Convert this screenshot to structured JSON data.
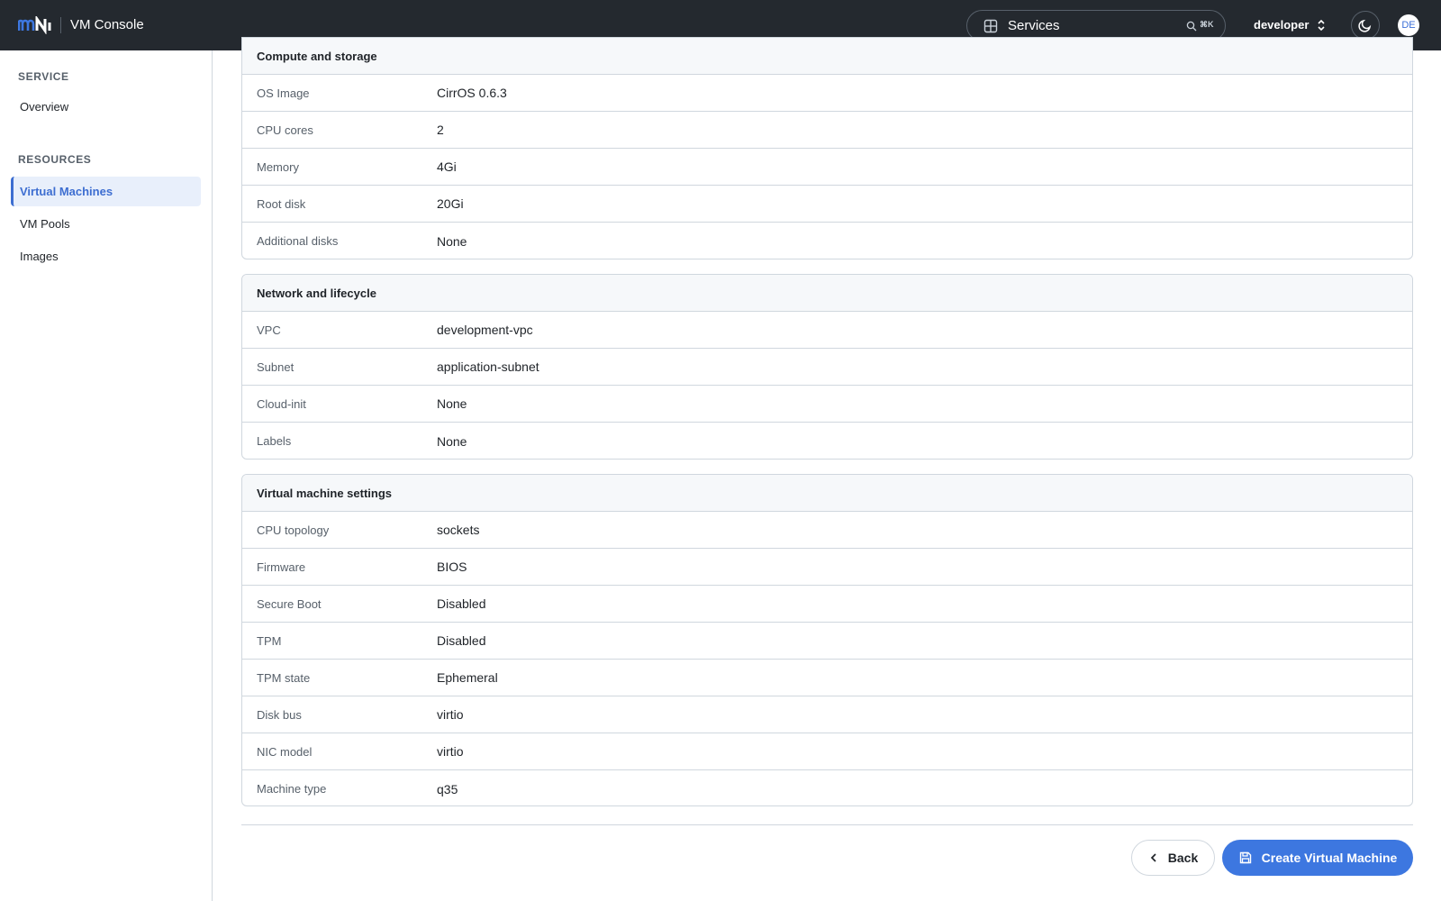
{
  "app": {
    "title": "VM Console"
  },
  "search": {
    "label": "Services",
    "shortcut": "⌘K"
  },
  "user": {
    "name": "developer",
    "initials": "DE"
  },
  "sidebar": {
    "sections": [
      {
        "title": "SERVICE",
        "items": [
          {
            "label": "Overview",
            "active": false
          }
        ]
      },
      {
        "title": "RESOURCES",
        "items": [
          {
            "label": "Virtual Machines",
            "active": true
          },
          {
            "label": "VM Pools",
            "active": false
          },
          {
            "label": "Images",
            "active": false
          }
        ]
      }
    ]
  },
  "cards": [
    {
      "title": "Compute and storage",
      "rows": [
        {
          "label": "OS Image",
          "value": "CirrOS 0.6.3"
        },
        {
          "label": "CPU cores",
          "value": "2"
        },
        {
          "label": "Memory",
          "value": "4Gi"
        },
        {
          "label": "Root disk",
          "value": "20Gi"
        },
        {
          "label": "Additional disks",
          "value": "None"
        }
      ]
    },
    {
      "title": "Network and lifecycle",
      "rows": [
        {
          "label": "VPC",
          "value": "development-vpc"
        },
        {
          "label": "Subnet",
          "value": "application-subnet"
        },
        {
          "label": "Cloud-init",
          "value": "None"
        },
        {
          "label": "Labels",
          "value": "None"
        }
      ]
    },
    {
      "title": "Virtual machine settings",
      "rows": [
        {
          "label": "CPU topology",
          "value": "sockets"
        },
        {
          "label": "Firmware",
          "value": "BIOS"
        },
        {
          "label": "Secure Boot",
          "value": "Disabled"
        },
        {
          "label": "TPM",
          "value": "Disabled"
        },
        {
          "label": "TPM state",
          "value": "Ephemeral"
        },
        {
          "label": "Disk bus",
          "value": "virtio"
        },
        {
          "label": "NIC model",
          "value": "virtio"
        },
        {
          "label": "Machine type",
          "value": "q35"
        }
      ]
    }
  ],
  "actions": {
    "back_label": "Back",
    "create_label": "Create Virtual Machine"
  },
  "colors": {
    "accent": "#3d77e0",
    "topbar": "#24292f",
    "active_nav_bg": "#e8effb"
  },
  "icons": {
    "grid": "grid-icon",
    "search": "search-icon",
    "chevron-updown": "chevron-updown-icon",
    "theme": "moon-icon",
    "back": "chevron-left-icon",
    "create": "save-icon"
  }
}
